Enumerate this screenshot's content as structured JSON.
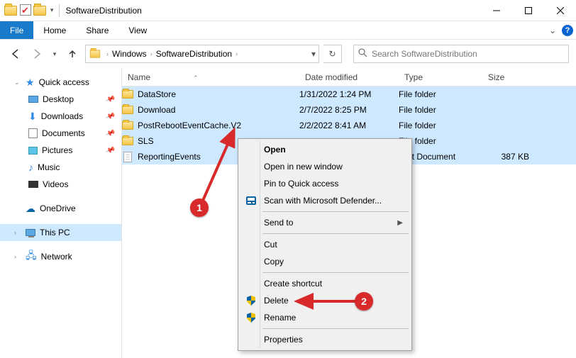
{
  "titlebar": {
    "title": "SoftwareDistribution"
  },
  "ribbon": {
    "file": "File",
    "tabs": [
      "Home",
      "Share",
      "View"
    ]
  },
  "address": {
    "crumbs": [
      "Windows",
      "SoftwareDistribution"
    ]
  },
  "search": {
    "placeholder": "Search SoftwareDistribution"
  },
  "sidebar": {
    "quick": "Quick access",
    "items": [
      {
        "label": "Desktop",
        "pin": true
      },
      {
        "label": "Downloads",
        "pin": true
      },
      {
        "label": "Documents",
        "pin": true
      },
      {
        "label": "Pictures",
        "pin": true
      },
      {
        "label": "Music",
        "pin": false
      },
      {
        "label": "Videos",
        "pin": false
      }
    ],
    "onedrive": "OneDrive",
    "thispc": "This PC",
    "network": "Network"
  },
  "columns": {
    "name": "Name",
    "date": "Date modified",
    "type": "Type",
    "size": "Size"
  },
  "rows": [
    {
      "name": "DataStore",
      "date": "1/31/2022 1:24 PM",
      "type": "File folder",
      "size": "",
      "icon": "folder"
    },
    {
      "name": "Download",
      "date": "2/7/2022 8:25 PM",
      "type": "File folder",
      "size": "",
      "icon": "folder"
    },
    {
      "name": "PostRebootEventCache.V2",
      "date": "2/2/2022 8:41 AM",
      "type": "File folder",
      "size": "",
      "icon": "folder"
    },
    {
      "name": "SLS",
      "date": "",
      "type": "File folder",
      "size": "",
      "icon": "folder"
    },
    {
      "name": "ReportingEvents",
      "date": "",
      "type": "Text Document",
      "size": "387 KB",
      "icon": "doc"
    }
  ],
  "ctx": {
    "open": "Open",
    "open_new": "Open in new window",
    "pin": "Pin to Quick access",
    "scan": "Scan with Microsoft Defender...",
    "sendto": "Send to",
    "cut": "Cut",
    "copy": "Copy",
    "shortcut": "Create shortcut",
    "delete": "Delete",
    "rename": "Rename",
    "props": "Properties"
  },
  "annotations": {
    "one": "1",
    "two": "2"
  }
}
